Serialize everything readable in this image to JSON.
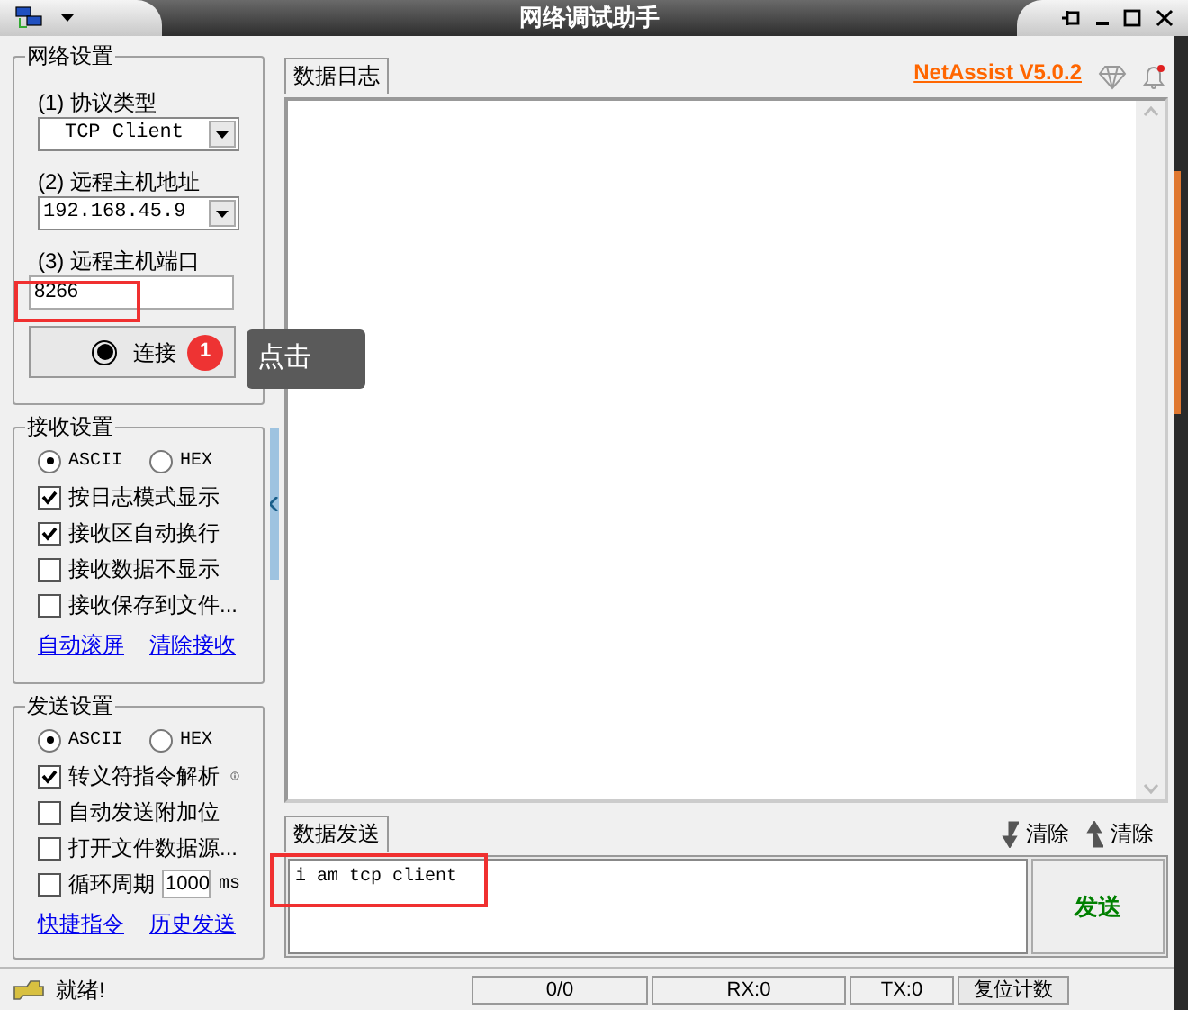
{
  "window": {
    "title": "网络调试助手"
  },
  "network_settings": {
    "title": "网络设置",
    "protocol_label": "(1) 协议类型",
    "protocol": "TCP Client",
    "host_label": "(2) 远程主机地址",
    "host": "192.168.45.9",
    "port_label": "(3) 远程主机端口",
    "port": "8266",
    "connect_button": "连接"
  },
  "annotation": {
    "badge": "1",
    "tooltip": "点击"
  },
  "receive_settings": {
    "title": "接收设置",
    "encodings": [
      {
        "label": "ASCII",
        "selected": true
      },
      {
        "label": "HEX",
        "selected": false
      }
    ],
    "options": [
      {
        "label": "按日志模式显示",
        "checked": true
      },
      {
        "label": "接收区自动换行",
        "checked": true
      },
      {
        "label": "接收数据不显示",
        "checked": false
      },
      {
        "label": "接收保存到文件...",
        "checked": false
      }
    ],
    "links": [
      "自动滚屏",
      "清除接收"
    ]
  },
  "send_settings": {
    "title": "发送设置",
    "encodings": [
      {
        "label": "ASCII",
        "selected": true
      },
      {
        "label": "HEX",
        "selected": false
      }
    ],
    "options": [
      {
        "kind": "info",
        "label": "转义符指令解析",
        "checked": true
      },
      {
        "kind": "plain",
        "label": "自动发送附加位",
        "checked": false
      },
      {
        "kind": "plain",
        "label": "打开文件数据源...",
        "checked": false
      },
      {
        "kind": "period",
        "label": "循环周期",
        "checked": false,
        "value": "1000",
        "unit": "ms"
      }
    ],
    "links": [
      "快捷指令",
      "历史发送"
    ]
  },
  "log_panel": {
    "tab": "数据日志",
    "version_link": "NetAssist V5.0.2"
  },
  "send_panel": {
    "tab": "数据发送",
    "clear_buttons": [
      "清除",
      "清除"
    ],
    "text": "i am tcp client",
    "send_button": "发送"
  },
  "status_bar": {
    "status": "就绪!",
    "counter": "0/0",
    "rx": "RX:0",
    "tx": "TX:0",
    "reset_button": "复位计数"
  }
}
